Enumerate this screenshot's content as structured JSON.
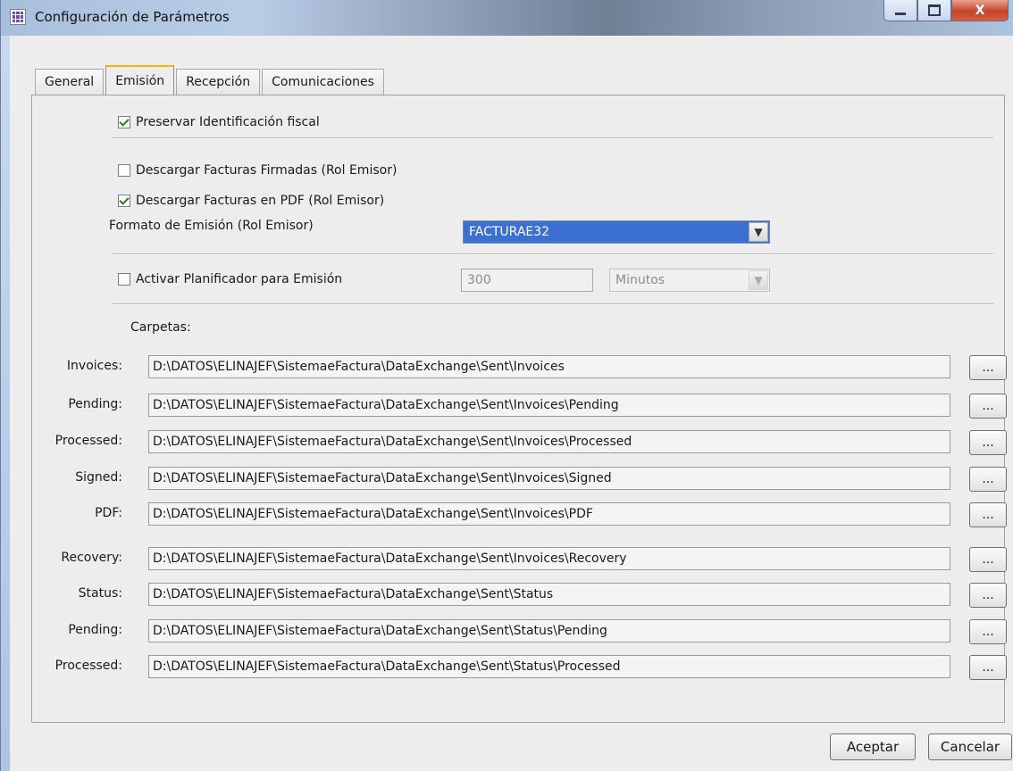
{
  "window": {
    "title": "Configuración de Parámetros",
    "close_glyph": "X"
  },
  "tabs": [
    {
      "label": "General",
      "active": false
    },
    {
      "label": "Emisión",
      "active": true
    },
    {
      "label": "Recepción",
      "active": false
    },
    {
      "label": "Comunicaciones",
      "active": false
    }
  ],
  "emision": {
    "preservar_label": "Preservar Identificación fiscal",
    "preservar_checked": true,
    "descargar_firmadas_label": "Descargar Facturas Firmadas (Rol Emisor)",
    "descargar_firmadas_checked": false,
    "descargar_pdf_label": "Descargar Facturas en PDF (Rol Emisor)",
    "descargar_pdf_checked": true,
    "formato_label": "Formato de Emisión (Rol Emisor)",
    "formato_value": "FACTURAE32",
    "planificador_label": "Activar Planificador para Emisión",
    "planificador_checked": false,
    "planificador_interval": "300",
    "planificador_unit": "Minutos",
    "carpetas_label": "Carpetas:"
  },
  "folders": [
    {
      "label": "Invoices:",
      "path": "D:\\DATOS\\ELINAJEF\\SistemaeFactura\\DataExchange\\Sent\\Invoices"
    },
    {
      "label": "Pending:",
      "path": "D:\\DATOS\\ELINAJEF\\SistemaeFactura\\DataExchange\\Sent\\Invoices\\Pending"
    },
    {
      "label": "Processed:",
      "path": "D:\\DATOS\\ELINAJEF\\SistemaeFactura\\DataExchange\\Sent\\Invoices\\Processed"
    },
    {
      "label": "Signed:",
      "path": "D:\\DATOS\\ELINAJEF\\SistemaeFactura\\DataExchange\\Sent\\Invoices\\Signed"
    },
    {
      "label": "PDF:",
      "path": "D:\\DATOS\\ELINAJEF\\SistemaeFactura\\DataExchange\\Sent\\Invoices\\PDF"
    },
    {
      "label": "Recovery:",
      "path": "D:\\DATOS\\ELINAJEF\\SistemaeFactura\\DataExchange\\Sent\\Invoices\\Recovery"
    },
    {
      "label": "Status:",
      "path": "D:\\DATOS\\ELINAJEF\\SistemaeFactura\\DataExchange\\Sent\\Status"
    },
    {
      "label": "Pending:",
      "path": "D:\\DATOS\\ELINAJEF\\SistemaeFactura\\DataExchange\\Sent\\Status\\Pending"
    },
    {
      "label": "Processed:",
      "path": "D:\\DATOS\\ELINAJEF\\SistemaeFactura\\DataExchange\\Sent\\Status\\Processed"
    }
  ],
  "browse_label": "...",
  "buttons": {
    "accept": "Aceptar",
    "cancel": "Cancelar"
  }
}
